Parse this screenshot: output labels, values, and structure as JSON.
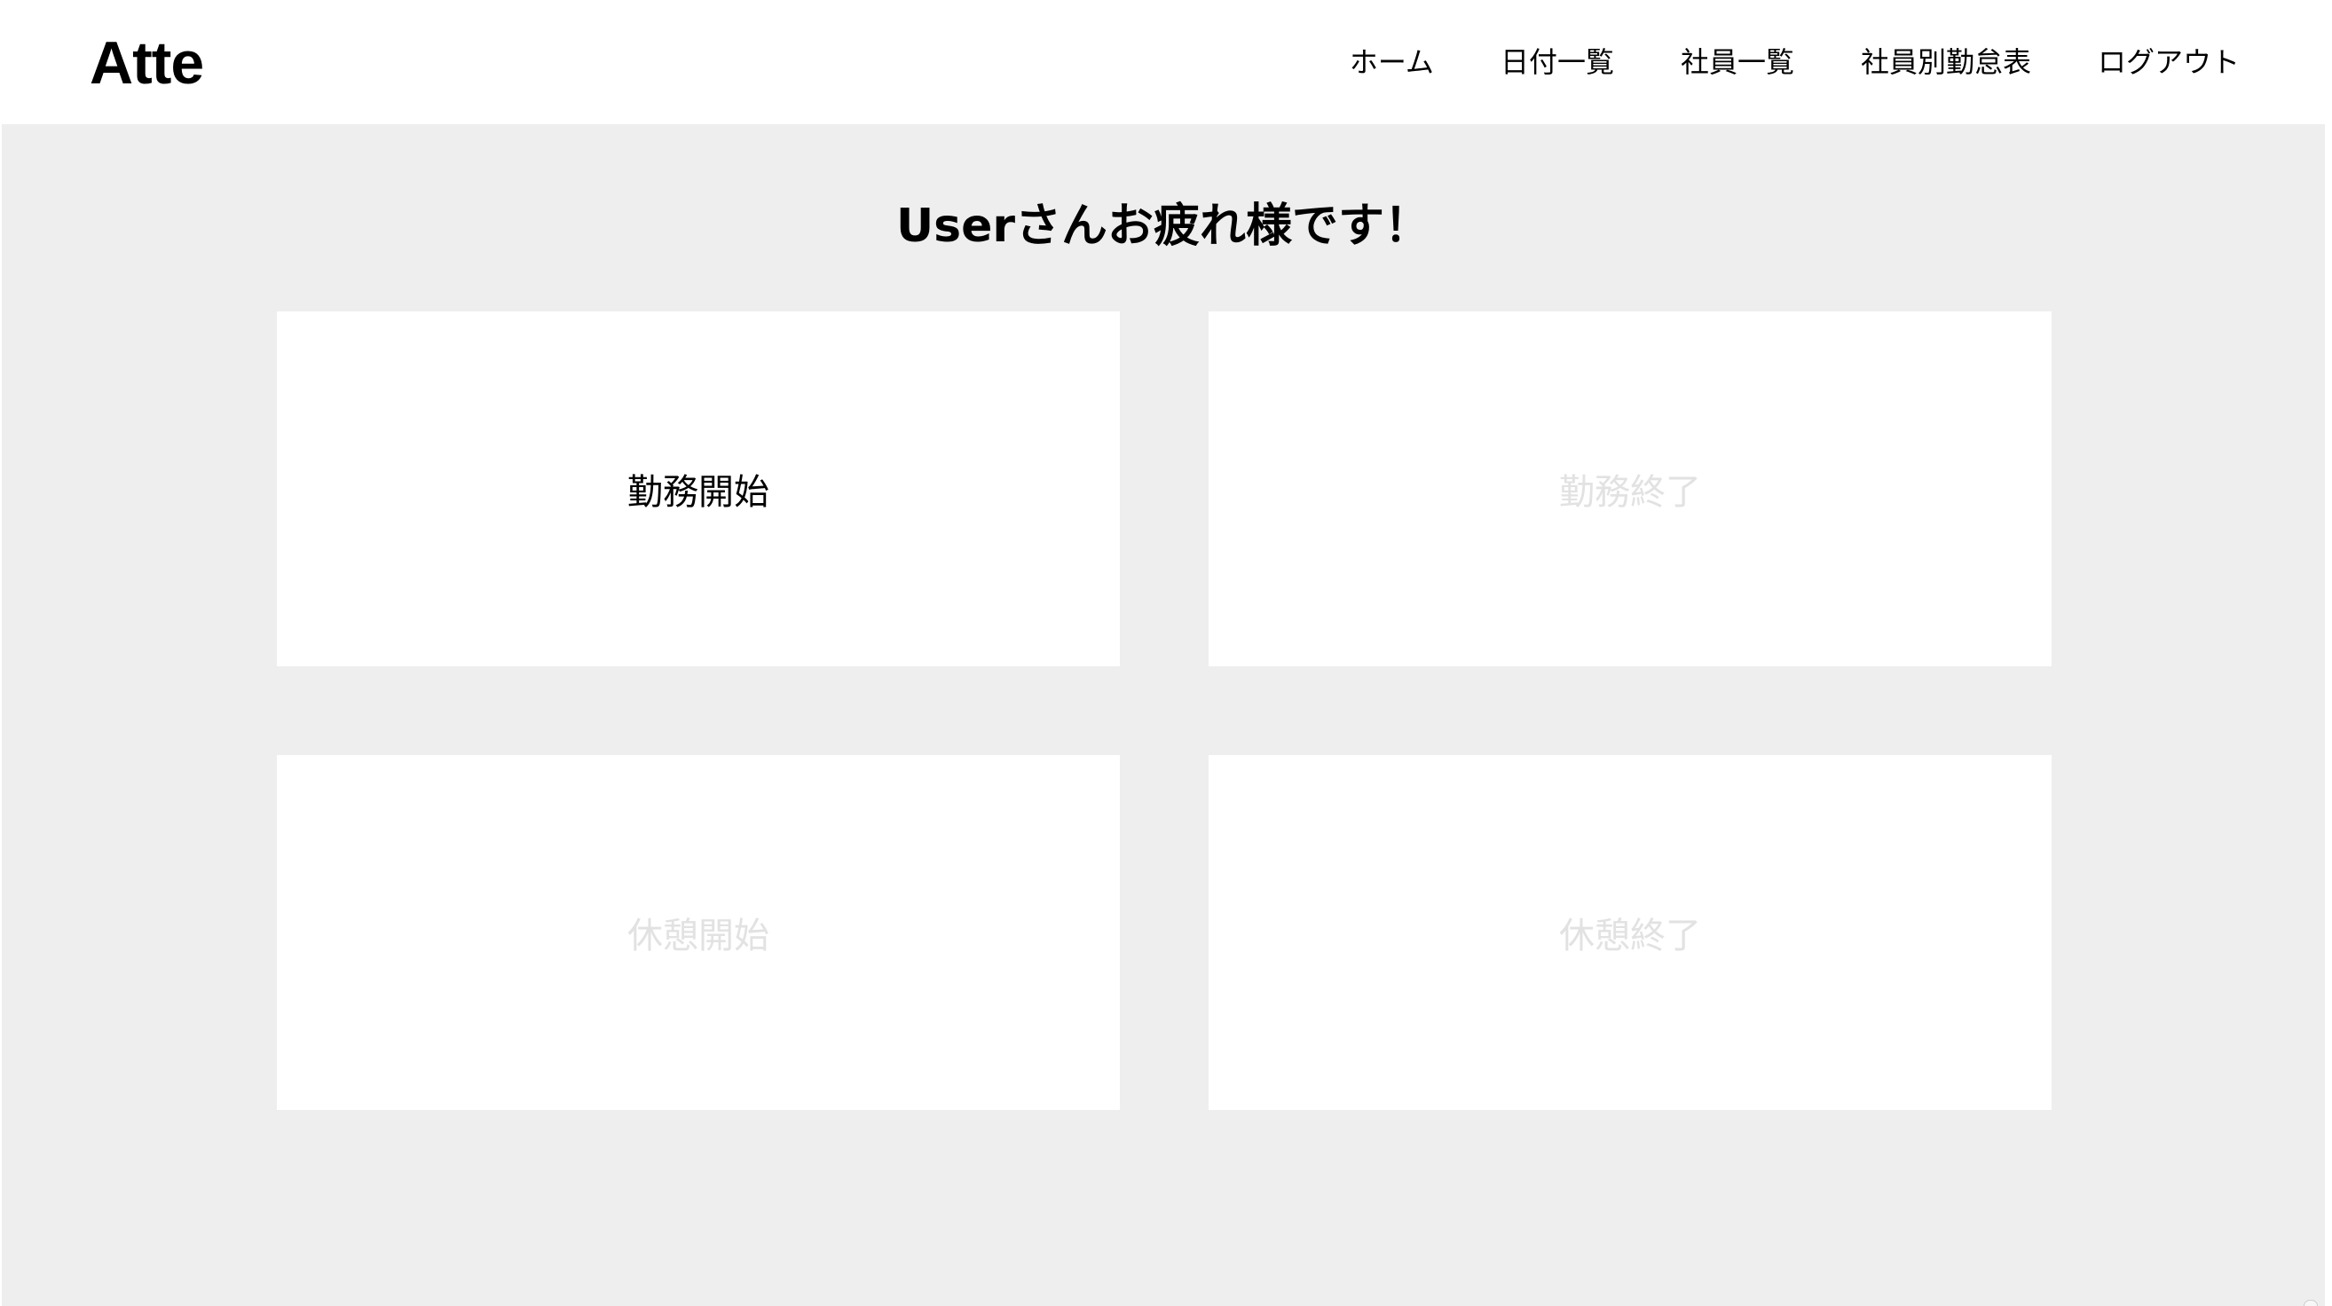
{
  "header": {
    "logo": "Atte",
    "nav": [
      {
        "label": "ホーム"
      },
      {
        "label": "日付一覧"
      },
      {
        "label": "社員一覧"
      },
      {
        "label": "社員別勤怠表"
      },
      {
        "label": "ログアウト"
      }
    ]
  },
  "main": {
    "greeting": "Userさんお疲れ様です！",
    "buttons": [
      {
        "label": "勤務開始",
        "state": "enabled"
      },
      {
        "label": "勤務終了",
        "state": "disabled"
      },
      {
        "label": "休憩開始",
        "state": "disabled"
      },
      {
        "label": "休憩終了",
        "state": "disabled"
      }
    ]
  },
  "colors": {
    "background": "#eeeeee",
    "card": "#ffffff",
    "text": "#000000",
    "disabled_text": "#e2e2e2"
  }
}
